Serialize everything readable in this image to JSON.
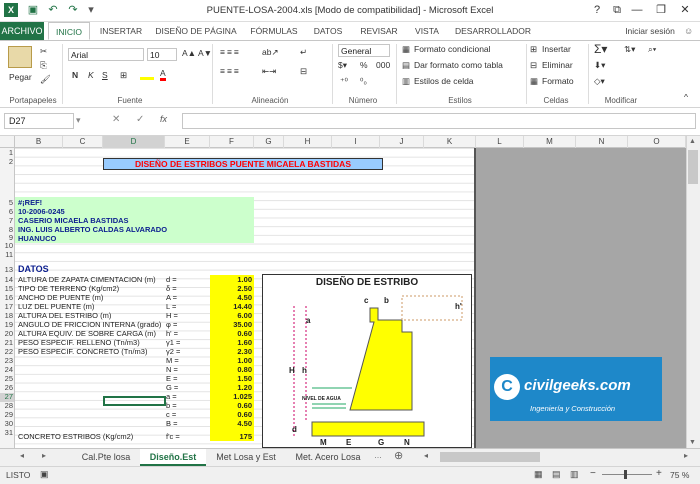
{
  "window": {
    "title": "PUENTE-LOSA-2004.xls  [Modo de compatibilidad] - Microsoft Excel"
  },
  "ribbon_tabs": [
    "ARCHIVO",
    "INICIO",
    "INSERTAR",
    "DISEÑO DE PÁGINA",
    "FÓRMULAS",
    "DATOS",
    "REVISAR",
    "VISTA",
    "DESARROLLADOR"
  ],
  "signin": "Iniciar sesión",
  "ribbon": {
    "paste": "Pegar",
    "font_name": "Arial",
    "font_size": "10",
    "number_format": "General",
    "cond_format": "Formato condicional",
    "table_format": "Dar formato como tabla",
    "cell_styles": "Estilos de celda",
    "insert": "Insertar",
    "delete": "Eliminar",
    "format": "Formato",
    "groups": [
      "Portapapeles",
      "Fuente",
      "Alineación",
      "Número",
      "Estilos",
      "Celdas",
      "Modificar"
    ]
  },
  "namebox": "D27",
  "fx": "fx",
  "columns": [
    "B",
    "C",
    "D",
    "E",
    "F",
    "G",
    "H",
    "I",
    "J",
    "K",
    "L",
    "M",
    "N",
    "O"
  ],
  "rows": [
    "1",
    "2",
    "5",
    "6",
    "7",
    "8",
    "9",
    "10",
    "11",
    "13",
    "14",
    "15",
    "16",
    "17",
    "18",
    "19",
    "20",
    "21",
    "22",
    "23",
    "24",
    "25",
    "26",
    "27",
    "28",
    "29",
    "30",
    "31"
  ],
  "sheet": {
    "header_title": "DISEÑO  DE  ESTRIBOS PUENTE MICAELA BASTIDAS",
    "info": [
      "#¡REF!",
      "10-2006-0245",
      "CASERIO MICAELA BASTIDAS",
      "ING. LUIS ALBERTO CALDAS ALVARADO",
      "HUANUCO"
    ],
    "datos": "DATOS",
    "rows": [
      {
        "label": "ALTURA DE ZAPATA CIMENTACION (m)",
        "sym": "d  =",
        "val": "1.00"
      },
      {
        "label": "TIPO DE TERRENO            (Kg/cm2)",
        "sym": "δ  =",
        "val": "2.50"
      },
      {
        "label": "ANCHO DE PUENTE              (m)",
        "sym": "A  =",
        "val": "4.50"
      },
      {
        "label": "LUZ DEL PUENTE                (m)",
        "sym": "L  =",
        "val": "14.40"
      },
      {
        "label": "ALTURA DEL ESTRIBO          (m)",
        "sym": "H  =",
        "val": "6.00"
      },
      {
        "label": "ANGULO DE FRICCION INTERNA (grado)",
        "sym": "φ  =",
        "val": "35.00"
      },
      {
        "label": "ALTURA EQUIV. DE SOBRE CARGA (m)",
        "sym": "h'  =",
        "val": "0.60"
      },
      {
        "label": "PESO ESPECIF. RELLENO       (Tn/m3)",
        "sym": "γ1 =",
        "val": "1.60"
      },
      {
        "label": "PESO ESPECIF. CONCRETO    (Tn/m3)",
        "sym": "γ2 =",
        "val": "2.30"
      },
      {
        "label": "",
        "sym": "M  =",
        "val": "1.00"
      },
      {
        "label": "",
        "sym": "N  =",
        "val": "0.80"
      },
      {
        "label": "",
        "sym": "E  =",
        "val": "1.50"
      },
      {
        "label": "",
        "sym": "G  =",
        "val": "1.20"
      },
      {
        "label": "",
        "sym": "a  =",
        "val": "1.025"
      },
      {
        "label": "",
        "sym": "b  =",
        "val": "0.60"
      },
      {
        "label": "",
        "sym": "c  =",
        "val": "0.60"
      },
      {
        "label": "",
        "sym": "B  =",
        "val": "4.50"
      },
      {
        "label": "CONCRETO ESTRIBOS (Kg/cm2)",
        "sym": "f'c  =",
        "val": "175"
      }
    ]
  },
  "drawing": {
    "title": "DISEÑO DE ESTRIBO",
    "labels": {
      "c": "c",
      "b": "b",
      "h_prime": "h'",
      "a": "a",
      "H": "H",
      "h": "h",
      "d": "d",
      "water": "NIVEL DE AGUA",
      "M": "M",
      "E": "E",
      "G": "G",
      "N": "N"
    }
  },
  "logo": {
    "name": "civilgeeks.com",
    "tagline": "Ingeniería y Construcción"
  },
  "sheet_tabs": [
    "Cal.Pte losa",
    "Diseño.Est",
    "Met Losa y Est",
    "Met. Acero Losa"
  ],
  "status": {
    "mode": "LISTO",
    "zoom": "75 %"
  },
  "colors": {
    "excel_green": "#217346",
    "yellow": "#ffff00",
    "green_fill": "#ccffcc",
    "navy": "#0c1f8f",
    "red_title": "#ff0000",
    "header_fill": "#99ccff"
  }
}
